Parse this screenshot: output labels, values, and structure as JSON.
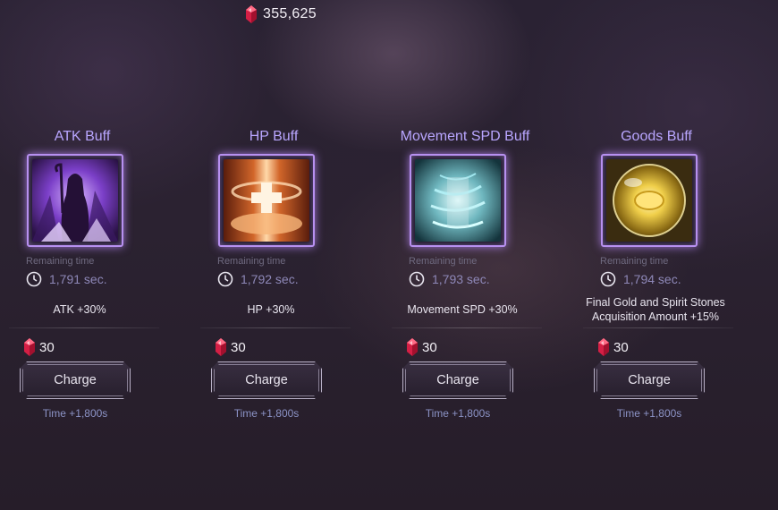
{
  "currency": {
    "amount": "355,625",
    "icon": "red-gem-icon"
  },
  "cards": [
    {
      "title": "ATK Buff",
      "remaining_label": "Remaining time",
      "timer": "1,791 sec.",
      "effect": "ATK +30%",
      "cost": "30",
      "charge_label": "Charge",
      "bonus": "Time +1,800s",
      "icon": "attack-buff-icon"
    },
    {
      "title": "HP Buff",
      "remaining_label": "Remaining time",
      "timer": "1,792 sec.",
      "effect": "HP +30%",
      "cost": "30",
      "charge_label": "Charge",
      "bonus": "Time +1,800s",
      "icon": "health-buff-icon"
    },
    {
      "title": "Movement SPD Buff",
      "remaining_label": "Remaining time",
      "timer": "1,793 sec.",
      "effect": "Movement SPD +30%",
      "cost": "30",
      "charge_label": "Charge",
      "bonus": "Time +1,800s",
      "icon": "speed-buff-icon"
    },
    {
      "title": "Goods Buff",
      "remaining_label": "Remaining time",
      "timer": "1,794 sec.",
      "effect_line1": "Final Gold and Spirit Stones",
      "effect_line2": "Acquisition Amount +15%",
      "cost": "30",
      "charge_label": "Charge",
      "bonus": "Time +1,800s",
      "icon": "goods-buff-icon"
    }
  ],
  "colors": {
    "title": "#b9a6ff",
    "frame": "#b790f0",
    "bonus": "#8c93c6",
    "gem": "#e0294f"
  }
}
